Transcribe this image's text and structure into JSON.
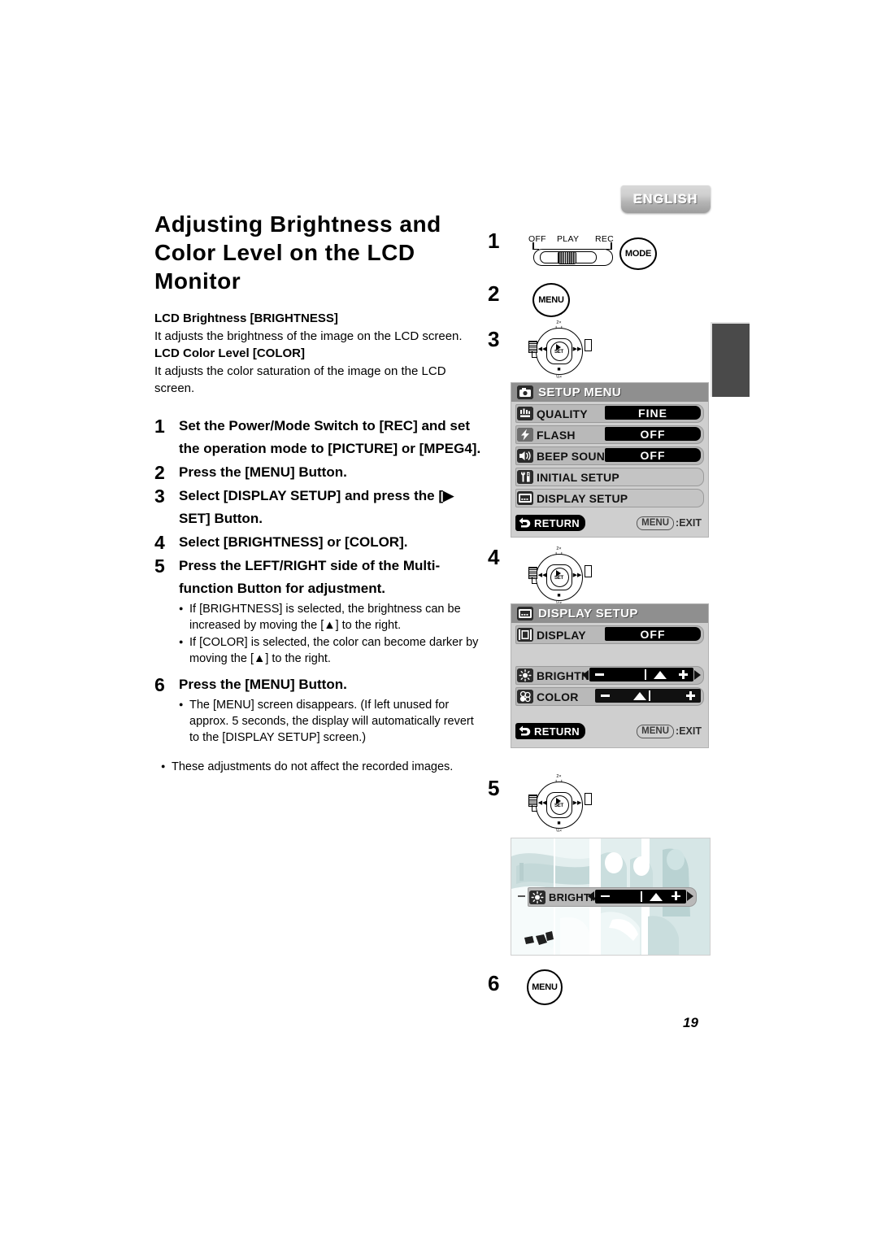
{
  "language_tab": {
    "label": "ENGLISH"
  },
  "page_number": "19",
  "heading": {
    "title": "Adjusting Brightness and Color Level on the LCD Monitor"
  },
  "intro": {
    "brightness_head": "LCD Brightness [BRIGHTNESS]",
    "brightness_body": "It adjusts the brightness of the image on the LCD screen.",
    "color_head": "LCD Color Level [COLOR]",
    "color_body": "It adjusts the color saturation of the image on the LCD screen."
  },
  "steps": [
    {
      "num": "1",
      "text": "Set the Power/Mode Switch to [REC] and set the operation mode to [PICTURE] or [MPEG4]."
    },
    {
      "num": "2",
      "text": "Press the [MENU] Button."
    },
    {
      "num": "3",
      "text": "Select [DISPLAY SETUP] and press the [▶ SET] Button."
    },
    {
      "num": "4",
      "text": "Select [BRIGHTNESS] or [COLOR]."
    },
    {
      "num": "5",
      "text": "Press the LEFT/RIGHT side of the Multi-function Button for adjustment."
    },
    {
      "num": "6",
      "text": "Press the [MENU] Button."
    }
  ],
  "step5_bullets": [
    "If [BRIGHTNESS] is selected, the brightness can be increased by moving the [▲] to the right.",
    "If [COLOR] is selected, the color can become darker by moving the [▲] to the right."
  ],
  "step6_bullets": [
    "The [MENU] screen disappears. (If left unused for approx. 5 seconds, the display will automatically revert to the [DISPLAY SETUP] screen.)"
  ],
  "outer_bullets": [
    "These adjustments do not affect the recorded images."
  ],
  "right_column": {
    "step_markers": [
      "1",
      "2",
      "3",
      "4",
      "5",
      "6"
    ],
    "power_switch": {
      "off_label": "OFF",
      "play_label": "PLAY",
      "rec_label": "REC",
      "icon": "power-mode-switch"
    },
    "mode_button_label": "MODE",
    "menu_button_label": "MENU",
    "dial": {
      "icon": "multi-function-dial",
      "set_label": "SET",
      "zoom_label": "2×",
      "pause_glyph": "❘❘",
      "stop_glyph": "■",
      "half_label": "½×",
      "prev_glyph": "◀◀",
      "next_glyph": "▶▶"
    }
  },
  "setup_menu": {
    "title": "SETUP MENU",
    "title_icon": "camera-icon",
    "rows": [
      {
        "label": "QUALITY",
        "value": "FINE",
        "icon": "quality-icon"
      },
      {
        "label": "FLASH",
        "value": "OFF",
        "icon": "flash-icon"
      },
      {
        "label": "BEEP SOUND",
        "value": "OFF",
        "icon": "beep-sound-icon"
      },
      {
        "label": "INITIAL SETUP",
        "value": "",
        "icon": "initial-setup-icon"
      },
      {
        "label": "DISPLAY SETUP",
        "value": "",
        "icon": "display-setup-icon"
      }
    ],
    "return_label": "RETURN",
    "exit_key": "MENU",
    "exit_label": ":EXIT"
  },
  "display_setup_menu": {
    "title": "DISPLAY SETUP",
    "title_icon": "display-setup-icon",
    "rows": [
      {
        "label": "DISPLAY",
        "value": "OFF",
        "icon": "display-icon",
        "type": "value"
      },
      {
        "label": "BRIGHTNESS",
        "value": "",
        "icon": "brightness-icon",
        "type": "slider",
        "selected": true,
        "minus": "−",
        "plus": "+"
      },
      {
        "label": "COLOR",
        "value": "",
        "icon": "color-icon",
        "type": "slider",
        "selected": false,
        "minus": "−",
        "plus": "+"
      }
    ],
    "return_label": "RETURN",
    "exit_key": "MENU",
    "exit_label": ":EXIT"
  },
  "lcd_preview": {
    "overlay_label": "BRIGHTNESS",
    "overlay_icon": "brightness-icon",
    "minus": "−",
    "plus": "+"
  },
  "colors": {
    "osd_title_bar": "#8f8f8f",
    "osd_body": "#cfcfcf",
    "osd_row": "#b9b9b9",
    "osd_value": "#000000",
    "side_tab": "#4a4a4a"
  }
}
